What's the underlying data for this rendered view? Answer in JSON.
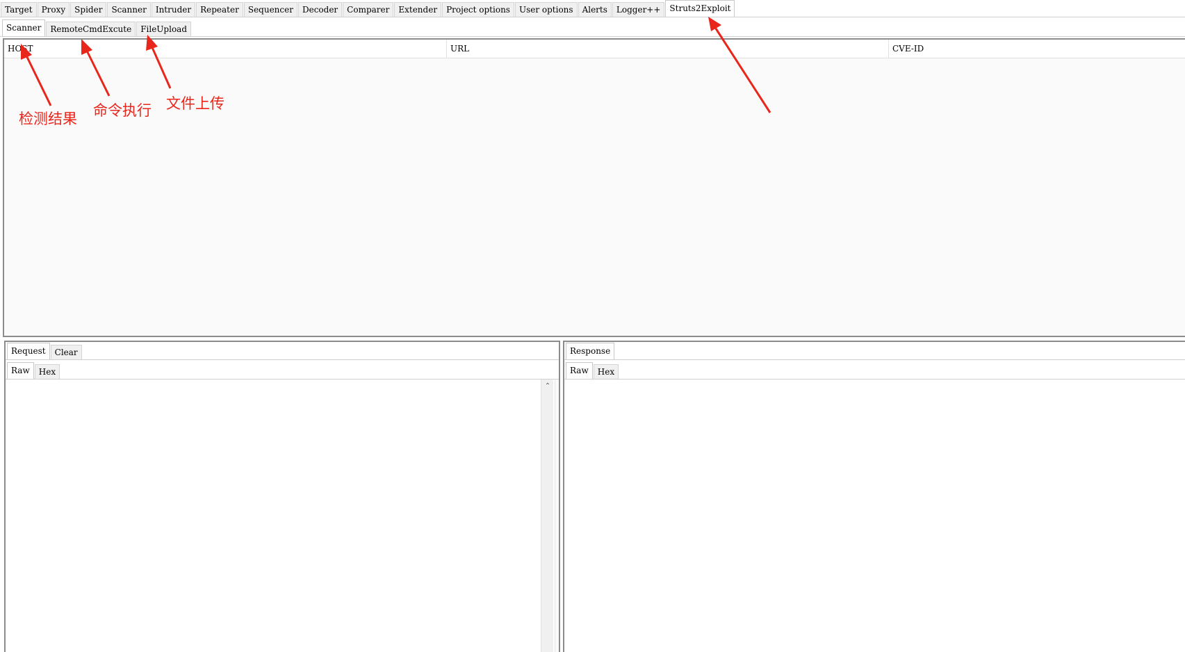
{
  "main_tabs": [
    {
      "label": "Target"
    },
    {
      "label": "Proxy"
    },
    {
      "label": "Spider"
    },
    {
      "label": "Scanner"
    },
    {
      "label": "Intruder"
    },
    {
      "label": "Repeater"
    },
    {
      "label": "Sequencer"
    },
    {
      "label": "Decoder"
    },
    {
      "label": "Comparer"
    },
    {
      "label": "Extender"
    },
    {
      "label": "Project options"
    },
    {
      "label": "User options"
    },
    {
      "label": "Alerts"
    },
    {
      "label": "Logger++"
    },
    {
      "label": "Struts2Exploit",
      "active": true
    }
  ],
  "sub_tabs": [
    {
      "label": "Scanner",
      "active": true
    },
    {
      "label": "RemoteCmdExcute"
    },
    {
      "label": "FileUpload"
    }
  ],
  "results_table": {
    "columns": [
      "HOST",
      "URL",
      "CVE-ID"
    ],
    "rows": []
  },
  "request_panel": {
    "tabs": [
      {
        "label": "Request",
        "active": true
      },
      {
        "label": "Clear"
      }
    ],
    "inner_tabs": [
      {
        "label": "Raw",
        "active": true
      },
      {
        "label": "Hex"
      }
    ]
  },
  "response_panel": {
    "tabs": [
      {
        "label": "Response",
        "active": true
      }
    ],
    "inner_tabs": [
      {
        "label": "Raw",
        "active": true
      },
      {
        "label": "Hex"
      }
    ]
  },
  "annotations": {
    "detect_results": "检测结果",
    "command_exec": "命令执行",
    "file_upload": "文件上传",
    "color": "#e8261b"
  }
}
